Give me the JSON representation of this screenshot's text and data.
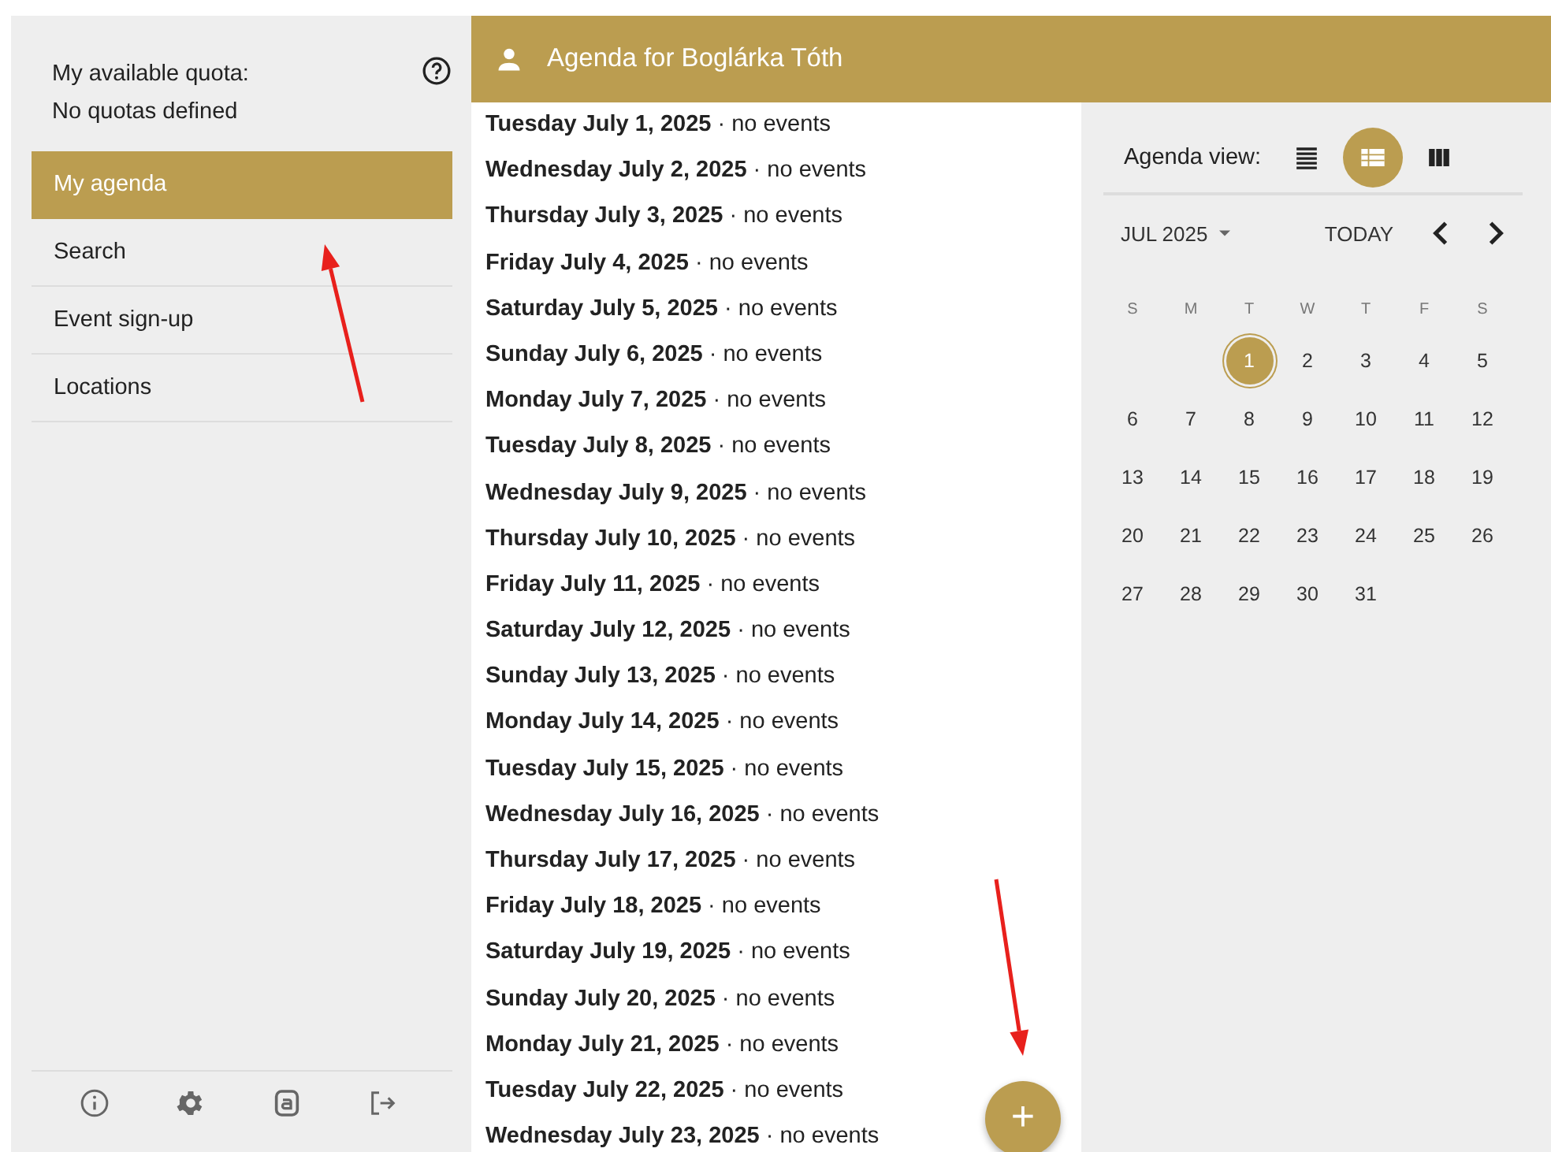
{
  "sidebar": {
    "quota_label": "My available quota:",
    "quota_value": "No quotas defined",
    "nav": [
      {
        "label": "My agenda",
        "selected": true
      },
      {
        "label": "Search",
        "selected": false
      },
      {
        "label": "Event sign-up",
        "selected": false
      },
      {
        "label": "Locations",
        "selected": false
      }
    ]
  },
  "header": {
    "title": "Agenda for Boglárka Tóth"
  },
  "agenda": [
    {
      "text": "**Tuesday July 1, 2025** · no events"
    },
    {
      "text": "**Wednesday July 2, 2025** · no events"
    },
    {
      "text": "**Thursday July 3, 2025** · no events"
    },
    {
      "text": "**Friday July 4, 2025** · no events"
    },
    {
      "text": "**Saturday July 5, 2025** · no events"
    },
    {
      "text": "**Sunday July 6, 2025** · no events"
    },
    {
      "text": "**Monday July 7, 2025** · no events"
    },
    {
      "text": "**Tuesday July 8, 2025** · no events"
    },
    {
      "text": "**Wednesday July 9, 2025** · no events"
    },
    {
      "text": "**Thursday July 10, 2025** · no events"
    },
    {
      "text": "**Friday July 11, 2025** · no events"
    },
    {
      "text": "**Saturday July 12, 2025** · no events"
    },
    {
      "text": "**Sunday July 13, 2025** · no events"
    },
    {
      "text": "**Monday July 14, 2025** · no events"
    },
    {
      "text": "**Tuesday July 15, 2025** · no events"
    },
    {
      "text": "**Wednesday July 16, 2025** · no events"
    },
    {
      "text": "**Thursday July 17, 2025** · no events"
    },
    {
      "text": "**Friday July 18, 2025** · no events"
    },
    {
      "text": "**Saturday July 19, 2025** · no events"
    },
    {
      "text": "**Sunday July 20, 2025** · no events"
    },
    {
      "text": "**Monday July 21, 2025** · no events"
    },
    {
      "text": "**Tuesday July 22, 2025** · no events"
    },
    {
      "text": "**Wednesday July 23, 2025** · no events"
    }
  ],
  "fab": {
    "label": "+"
  },
  "calendar": {
    "view_label": "Agenda view:",
    "view_options": [
      {
        "kind": "list",
        "selected": false
      },
      {
        "kind": "table",
        "selected": true
      },
      {
        "kind": "columns",
        "selected": false
      }
    ],
    "month": "JUL 2025",
    "today": "TODAY",
    "weekdays": [
      "S",
      "M",
      "T",
      "W",
      "T",
      "F",
      "S"
    ],
    "weeks": [
      [
        {
          "day": "1",
          "selected": true
        },
        {
          "day": "2",
          "selected": false
        },
        {
          "day": "3",
          "selected": false
        },
        {
          "day": "4",
          "selected": false
        },
        {
          "day": "5",
          "selected": false
        }
      ],
      [
        {
          "day": "6",
          "selected": false
        },
        {
          "day": "7",
          "selected": false
        },
        {
          "day": "8",
          "selected": false
        },
        {
          "day": "9",
          "selected": false
        },
        {
          "day": "10",
          "selected": false
        },
        {
          "day": "11",
          "selected": false
        },
        {
          "day": "12",
          "selected": false
        }
      ],
      [
        {
          "day": "13",
          "selected": false
        },
        {
          "day": "14",
          "selected": false
        },
        {
          "day": "15",
          "selected": false
        },
        {
          "day": "16",
          "selected": false
        },
        {
          "day": "17",
          "selected": false
        },
        {
          "day": "18",
          "selected": false
        },
        {
          "day": "19",
          "selected": false
        }
      ],
      [
        {
          "day": "20",
          "selected": false
        },
        {
          "day": "21",
          "selected": false
        },
        {
          "day": "22",
          "selected": false
        },
        {
          "day": "23",
          "selected": false
        },
        {
          "day": "24",
          "selected": false
        },
        {
          "day": "25",
          "selected": false
        },
        {
          "day": "26",
          "selected": false
        }
      ],
      [
        {
          "day": "27",
          "selected": false
        },
        {
          "day": "28",
          "selected": false
        },
        {
          "day": "29",
          "selected": false
        },
        {
          "day": "30",
          "selected": false
        },
        {
          "day": "31",
          "selected": false
        }
      ]
    ]
  }
}
